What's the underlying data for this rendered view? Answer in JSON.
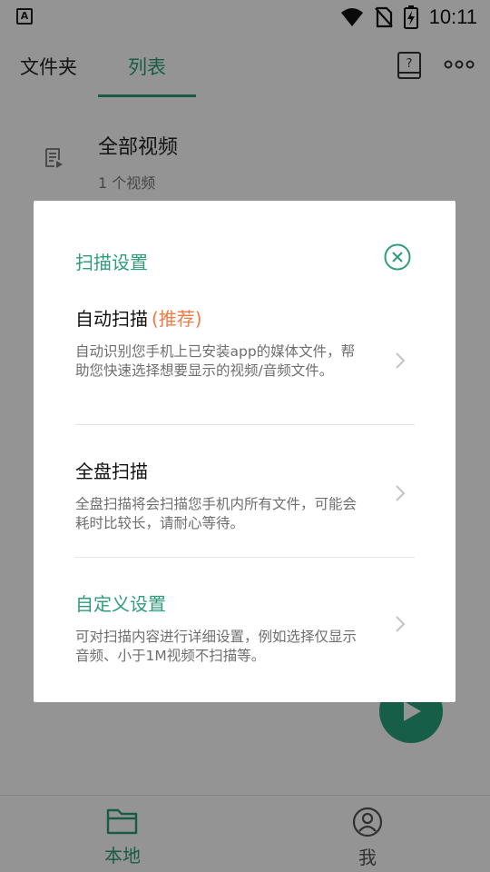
{
  "status_bar": {
    "time": "10:11",
    "left_icon_letter": "A"
  },
  "header": {
    "tabs": [
      {
        "label": "文件夹",
        "active": false
      },
      {
        "label": "列表",
        "active": true
      }
    ],
    "accent_color": "#2e9d78"
  },
  "list": {
    "items": [
      {
        "title": "全部视频",
        "count": "1 个视频"
      }
    ]
  },
  "bottom_nav": {
    "items": [
      {
        "label": "本地",
        "icon": "folder-icon",
        "active": true
      },
      {
        "label": "我",
        "icon": "profile-icon",
        "active": false
      }
    ]
  },
  "dialog": {
    "title": "扫描设置",
    "options": [
      {
        "title": "自动扫描",
        "badge": "(推荐)",
        "desc": "自动识别您手机上已安装app的媒体文件，帮助您快速选择想要显示的视频/音频文件。"
      },
      {
        "title": "全盘扫描",
        "desc": "全盘扫描将会扫描您手机内所有文件，可能会耗时比较长，请耐心等待。"
      },
      {
        "title": "自定义设置",
        "desc": "可对扫描内容进行详细设置，例如选择仅显示音频、小于1M视频不扫描等。"
      }
    ]
  },
  "colors": {
    "accent": "#2e9d78",
    "badge": "#f07b45",
    "fab": "#27a27c"
  }
}
